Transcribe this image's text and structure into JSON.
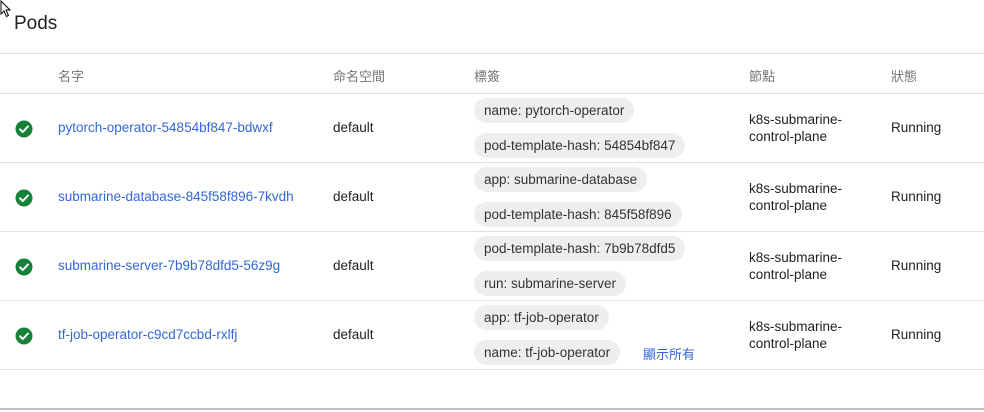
{
  "page": {
    "title": "Pods"
  },
  "table": {
    "headers": {
      "name": "名字",
      "namespace": "命名空間",
      "labels": "標簽",
      "node": "節點",
      "status": "狀態"
    },
    "show_all_label": "顯示所有",
    "status_color": "#188038",
    "link_color": "#3367d6",
    "rows": [
      {
        "status_icon": "check-circle-icon",
        "name": "pytorch-operator-54854bf847-bdwxf",
        "namespace": "default",
        "labels": [
          "name: pytorch-operator",
          "pod-template-hash: 54854bf847"
        ],
        "node_line1": "k8s-submarine-",
        "node_line2": "control-plane",
        "status": "Running"
      },
      {
        "status_icon": "check-circle-icon",
        "name": "submarine-database-845f58f896-7kvdh",
        "namespace": "default",
        "labels": [
          "app: submarine-database",
          "pod-template-hash: 845f58f896"
        ],
        "node_line1": "k8s-submarine-",
        "node_line2": "control-plane",
        "status": "Running"
      },
      {
        "status_icon": "check-circle-icon",
        "name": "submarine-server-7b9b78dfd5-56z9g",
        "namespace": "default",
        "labels": [
          "pod-template-hash: 7b9b78dfd5",
          "run: submarine-server"
        ],
        "node_line1": "k8s-submarine-",
        "node_line2": "control-plane",
        "status": "Running"
      },
      {
        "status_icon": "check-circle-icon",
        "name": "tf-job-operator-c9cd7ccbd-rxlfj",
        "namespace": "default",
        "labels": [
          "app: tf-job-operator",
          "name: tf-job-operator"
        ],
        "node_line1": "k8s-submarine-",
        "node_line2": "control-plane",
        "status": "Running"
      }
    ]
  }
}
